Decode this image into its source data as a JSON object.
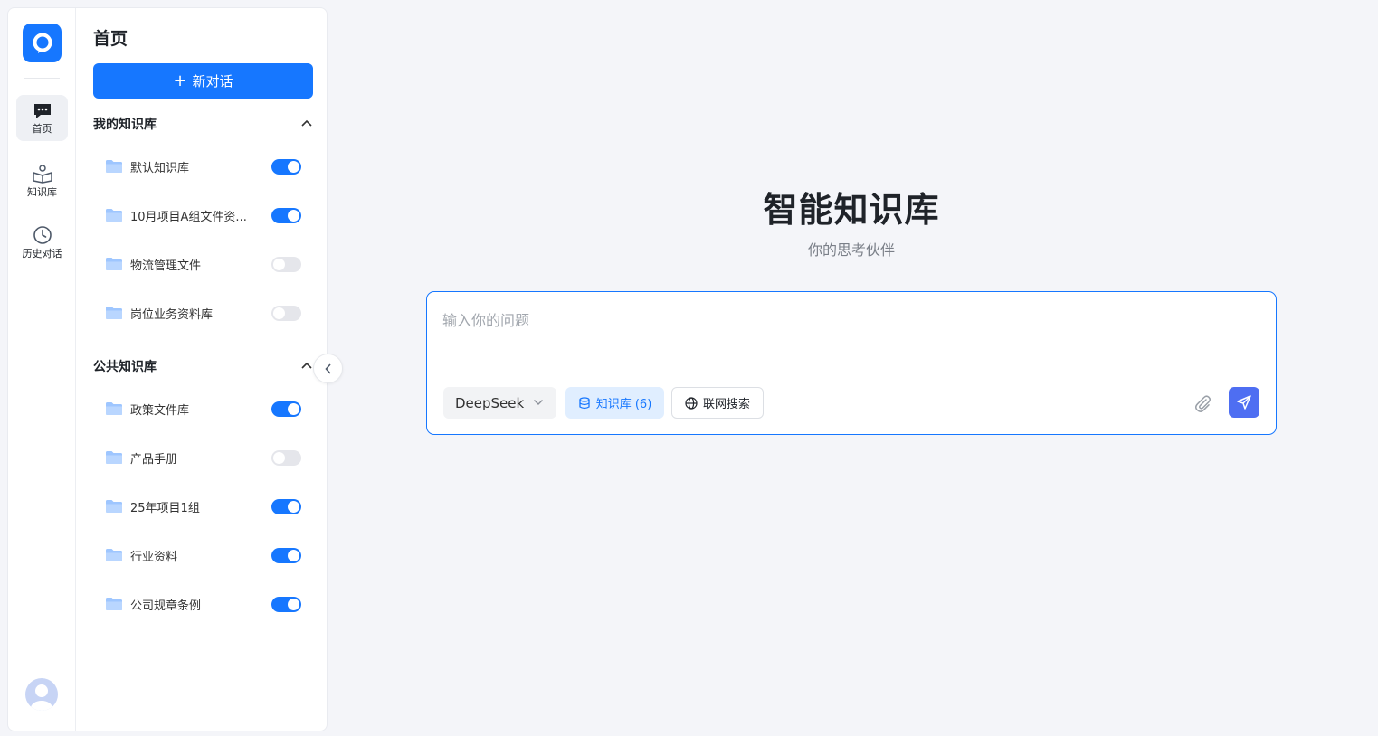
{
  "rail": {
    "items": [
      {
        "label": "首页",
        "icon": "chat-bubble-icon",
        "active": true
      },
      {
        "label": "知识库",
        "icon": "book-reader-icon",
        "active": false
      },
      {
        "label": "历史对话",
        "icon": "clock-icon",
        "active": false
      }
    ]
  },
  "panel": {
    "title": "首页",
    "new_chat_label": "新对话",
    "my_kb": {
      "title": "我的知识库",
      "items": [
        {
          "name": "默认知识库",
          "enabled": true
        },
        {
          "name": "10月项目A组文件资...",
          "enabled": true
        },
        {
          "name": "物流管理文件",
          "enabled": false
        },
        {
          "name": "岗位业务资料库",
          "enabled": false
        }
      ]
    },
    "public_kb": {
      "title": "公共知识库",
      "items": [
        {
          "name": "政策文件库",
          "enabled": true
        },
        {
          "name": "产品手册",
          "enabled": false
        },
        {
          "name": "25年项目1组",
          "enabled": true
        },
        {
          "name": "行业资料",
          "enabled": true
        },
        {
          "name": "公司规章条例",
          "enabled": true
        }
      ]
    }
  },
  "main": {
    "title": "智能知识库",
    "subtitle": "你的思考伙伴",
    "composer": {
      "placeholder": "输入你的问题",
      "model": "DeepSeek",
      "kb_chip": "知识库 (6)",
      "web_chip": "联网搜索"
    }
  },
  "colors": {
    "accent": "#1677ff",
    "send_button": "#4e6ef2",
    "background": "#f4f5f9"
  }
}
